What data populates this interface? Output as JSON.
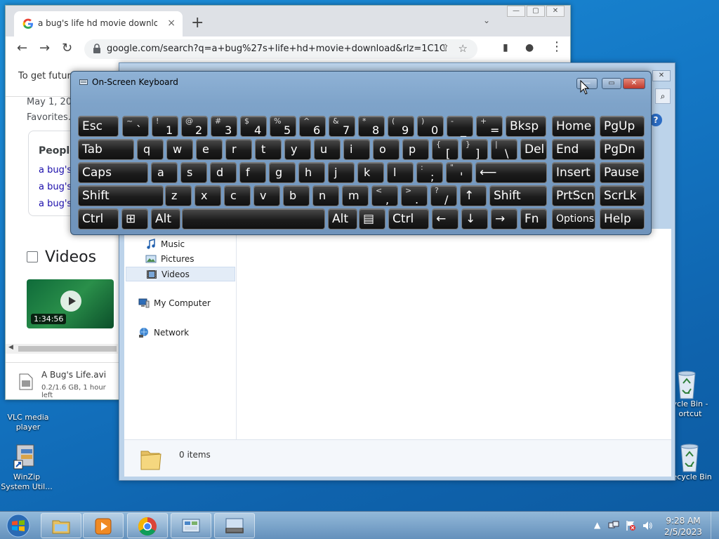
{
  "chrome": {
    "tab_title": "a bug's life hd movie download",
    "tab_close": "×",
    "new_tab": "+",
    "tab_dropdown": "⌄",
    "win_min": "—",
    "win_max": "▢",
    "win_close": "✕",
    "back": "←",
    "forward": "→",
    "reload": "↻",
    "url": "google.com/search?q=a+bug%27s+life+hd+movie+download&rlz=1C1GC...",
    "share": "⇪",
    "star": "☆",
    "sidepanel": "▮",
    "profile": "●",
    "menu": "⋮",
    "infobar_text": "To get future",
    "date_text": "May 1, 20",
    "favorites_text": "Favorites.",
    "people_header": "People",
    "people_links": [
      "a bug's",
      "a bug's",
      "a bug's"
    ],
    "videos_heading": "Videos",
    "video_duration": "1:34:56",
    "download": {
      "name": "A Bug's Life.avi",
      "meta": "0.2/1.6 GB, 1 hour left"
    }
  },
  "explorer": {
    "close": "✕",
    "search": "⌕",
    "help": "?",
    "nav_items": [
      {
        "label": "Music",
        "icon": "music-icon"
      },
      {
        "label": "Pictures",
        "icon": "pictures-icon"
      },
      {
        "label": "Videos",
        "icon": "videos-icon"
      },
      {
        "label": "My Computer",
        "icon": "computer-icon"
      },
      {
        "label": "Network",
        "icon": "network-icon"
      }
    ],
    "item_count": "0 items"
  },
  "osk": {
    "title": "On-Screen Keyboard",
    "min_label": "—",
    "max_label": "▭",
    "close_label": "✕",
    "rows": [
      [
        {
          "id": "esc",
          "label": "Esc"
        },
        {
          "id": "tilde",
          "top": "~",
          "bottom": "`"
        },
        {
          "id": "1",
          "top": "!",
          "bottom": "1"
        },
        {
          "id": "2",
          "top": "@",
          "bottom": "2"
        },
        {
          "id": "3",
          "top": "#",
          "bottom": "3"
        },
        {
          "id": "4",
          "top": "$",
          "bottom": "4"
        },
        {
          "id": "5",
          "top": "%",
          "bottom": "5"
        },
        {
          "id": "6",
          "top": "^",
          "bottom": "6"
        },
        {
          "id": "7",
          "top": "&",
          "bottom": "7"
        },
        {
          "id": "8",
          "top": "*",
          "bottom": "8"
        },
        {
          "id": "9",
          "top": "(",
          "bottom": "9"
        },
        {
          "id": "0",
          "top": ")",
          "bottom": "0"
        },
        {
          "id": "minus",
          "top": "-",
          "bottom": "_"
        },
        {
          "id": "equals",
          "top": "+",
          "bottom": "="
        },
        {
          "id": "bksp",
          "label": "Bksp"
        },
        {
          "id": "home",
          "label": "Home"
        },
        {
          "id": "pgup",
          "label": "PgUp"
        }
      ],
      [
        {
          "id": "tab",
          "label": "Tab"
        },
        {
          "id": "q",
          "label": "q"
        },
        {
          "id": "w",
          "label": "w"
        },
        {
          "id": "e",
          "label": "e"
        },
        {
          "id": "r",
          "label": "r"
        },
        {
          "id": "t",
          "label": "t"
        },
        {
          "id": "y",
          "label": "y"
        },
        {
          "id": "u",
          "label": "u"
        },
        {
          "id": "i",
          "label": "i"
        },
        {
          "id": "o",
          "label": "o"
        },
        {
          "id": "p",
          "label": "p"
        },
        {
          "id": "lbracket",
          "top": "{",
          "bottom": "["
        },
        {
          "id": "rbracket",
          "top": "}",
          "bottom": "]"
        },
        {
          "id": "backslash",
          "top": "|",
          "bottom": "\\"
        },
        {
          "id": "del",
          "label": "Del"
        },
        {
          "id": "end",
          "label": "End"
        },
        {
          "id": "pgdn",
          "label": "PgDn"
        }
      ],
      [
        {
          "id": "caps",
          "label": "Caps"
        },
        {
          "id": "a",
          "label": "a"
        },
        {
          "id": "s",
          "label": "s"
        },
        {
          "id": "d",
          "label": "d"
        },
        {
          "id": "f",
          "label": "f"
        },
        {
          "id": "g",
          "label": "g"
        },
        {
          "id": "h",
          "label": "h"
        },
        {
          "id": "j",
          "label": "j"
        },
        {
          "id": "k",
          "label": "k"
        },
        {
          "id": "l",
          "label": "l"
        },
        {
          "id": "semicolon",
          "top": ":",
          "bottom": ";"
        },
        {
          "id": "quote",
          "top": "\"",
          "bottom": "'"
        },
        {
          "id": "enter",
          "label": "⟵"
        },
        {
          "id": "insert",
          "label": "Insert"
        },
        {
          "id": "pause",
          "label": "Pause"
        }
      ],
      [
        {
          "id": "lshift",
          "label": "Shift"
        },
        {
          "id": "z",
          "label": "z"
        },
        {
          "id": "x",
          "label": "x"
        },
        {
          "id": "c",
          "label": "c"
        },
        {
          "id": "v",
          "label": "v"
        },
        {
          "id": "b",
          "label": "b"
        },
        {
          "id": "n",
          "label": "n"
        },
        {
          "id": "m",
          "label": "m"
        },
        {
          "id": "comma",
          "top": "<",
          "bottom": ","
        },
        {
          "id": "period",
          "top": ">",
          "bottom": "."
        },
        {
          "id": "slash",
          "top": "?",
          "bottom": "/"
        },
        {
          "id": "up",
          "label": "↑"
        },
        {
          "id": "rshift",
          "label": "Shift"
        },
        {
          "id": "prtscn",
          "label": "PrtScn"
        },
        {
          "id": "scrlk",
          "label": "ScrLk"
        }
      ],
      [
        {
          "id": "lctrl",
          "label": "Ctrl"
        },
        {
          "id": "win",
          "label": "⊞"
        },
        {
          "id": "lalt",
          "label": "Alt"
        },
        {
          "id": "space",
          "label": ""
        },
        {
          "id": "ralt",
          "label": "Alt"
        },
        {
          "id": "menu",
          "label": "▤"
        },
        {
          "id": "rctrl",
          "label": "Ctrl"
        },
        {
          "id": "left",
          "label": "←"
        },
        {
          "id": "down",
          "label": "↓"
        },
        {
          "id": "right",
          "label": "→"
        },
        {
          "id": "fn",
          "label": "Fn"
        },
        {
          "id": "options",
          "label": "Options"
        },
        {
          "id": "help",
          "label": "Help"
        }
      ]
    ]
  },
  "desktop": {
    "icons": [
      {
        "name": "vlc",
        "label": "VLC media player"
      },
      {
        "name": "winzip",
        "label": "WinZip System Util..."
      },
      {
        "name": "recycle-shortcut",
        "label": "ycle Bin - ortcut"
      },
      {
        "name": "recycle-bin",
        "label": "Recycle Bin"
      }
    ]
  },
  "taskbar": {
    "time": "9:28 AM",
    "date": "2/5/2023",
    "tray_arrow": "▲"
  }
}
